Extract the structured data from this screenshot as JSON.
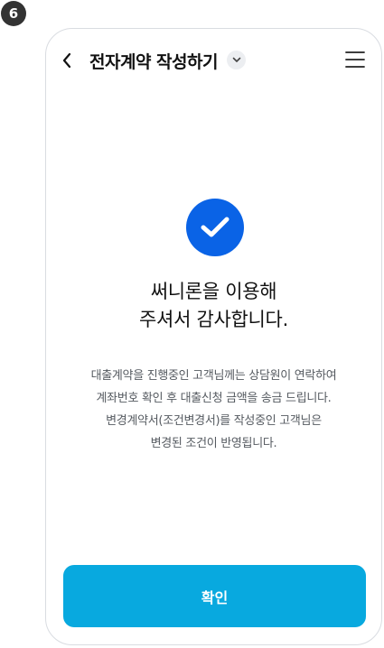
{
  "step_badge": "6",
  "header": {
    "title": "전자계약 작성하기",
    "back_icon": "chevron-left-icon",
    "dropdown_icon": "chevron-down-icon",
    "menu_icon": "hamburger-menu-icon"
  },
  "main": {
    "status_icon": "check-circle-icon",
    "title_lines": [
      "써니론을 이용해",
      "주셔서 감사합니다."
    ],
    "notice_lines": [
      "대출계약을 진행중인 고객님께는 상담원이 연락하여",
      "계좌번호 확인 후 대출신청 금액을 송금 드립니다.",
      "변경계약서(조건변경서)를 작성중인 고객님은",
      "변경된 조건이 반영됩니다."
    ]
  },
  "footer": {
    "confirm_label": "확인"
  },
  "colors": {
    "accent_blue": "#0a63e6",
    "button_cyan": "#08a9df",
    "badge_dark": "#333333"
  }
}
